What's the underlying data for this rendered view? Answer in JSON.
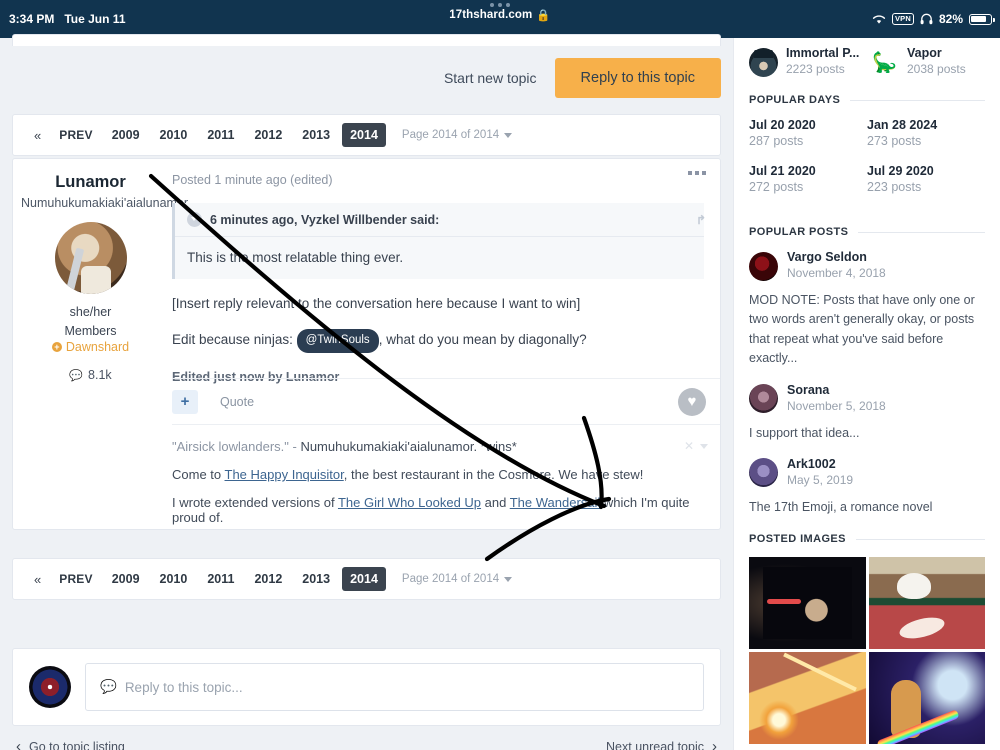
{
  "statusbar": {
    "time": "3:34 PM",
    "date": "Tue Jun 11",
    "url": "17thshard.com",
    "lock_icon": "lock-icon",
    "wifi_icon": "wifi-icon",
    "vpn_label": "VPN",
    "headphones_icon": "headphones-icon",
    "battery_percent": "82%",
    "battery_icon": "battery-icon",
    "bg_color": "#11344f"
  },
  "toolbar": {
    "start_new_topic": "Start new topic",
    "reply_to_topic": "Reply to this topic",
    "accent_color": "#f7b04a"
  },
  "pagination": {
    "first_chevron": "«",
    "prev_label": "PREV",
    "pages": [
      "2009",
      "2010",
      "2011",
      "2012",
      "2013",
      "2014"
    ],
    "active_page": "2014",
    "page_label": "Page 2014 of 2014"
  },
  "post": {
    "author": {
      "name": "Lunamor",
      "title": "Numuhukumakiaki'aialunamor",
      "pronouns": "she/her",
      "group": "Members",
      "badge": "Dawnshard",
      "post_count": "8.1k",
      "avatar": "user-avatar"
    },
    "posted_line": "Posted 1 minute ago (edited)",
    "menu_icon": "more-options-icon",
    "quote": {
      "header": "6 minutes ago, Vyzkel Willbender said:",
      "collapse_icon": "collapse-icon",
      "share_icon": "share-arrow-icon",
      "text": "This is the most relatable thing ever."
    },
    "paragraph_1": "[Insert reply relevant to the conversation here because I want to win]",
    "paragraph_2_prefix": "Edit because ninjas:",
    "mention": "@TwinSouls",
    "paragraph_2_suffix": ", what do you mean by diagonally?",
    "edited_note": "Edited just now by Lunamor",
    "tools": {
      "plus_label": "+",
      "quote_label": "Quote",
      "react_icon": "heart-icon"
    },
    "signature": {
      "line1_quote": "\"Airsick lowlanders.\" - ",
      "line1_rest": "Numuhukumakiaki'aialunamor. *wins*",
      "line2_pre": "Come to ",
      "line2_link": "The Happy Inquisitor",
      "line2_post": ", the best restaurant in the Cosmere. We have stew!",
      "line3_pre": "I wrote extended versions of ",
      "line3_link1": "The Girl Who Looked Up",
      "line3_mid": " and ",
      "line3_link2": "The Wandersail",
      "line3_post": " which I'm quite proud of.",
      "close_icon": "close-icon",
      "caret_icon": "chevron-down-icon"
    }
  },
  "composer": {
    "avatar": "current-user-avatar",
    "placeholder": "Reply to this topic...",
    "icon": "comment-icon"
  },
  "bottom_nav": {
    "left_label": "Go to topic listing",
    "left_icon": "chevron-left-icon",
    "right_label": "Next unread topic",
    "right_icon": "chevron-right-icon"
  },
  "sidebar": {
    "top_users": [
      {
        "name": "Immortal P...",
        "posts": "2223 posts",
        "avatar": "user-avatar"
      },
      {
        "name": "Vapor",
        "posts": "2038 posts",
        "avatar": "dinosaur-avatar",
        "glyph": "🦕"
      }
    ],
    "popular_days": {
      "title": "POPULAR DAYS",
      "items": [
        {
          "date": "Jul 20 2020",
          "posts": "287 posts"
        },
        {
          "date": "Jan 28 2024",
          "posts": "273 posts"
        },
        {
          "date": "Jul 21 2020",
          "posts": "272 posts"
        },
        {
          "date": "Jul 29 2020",
          "posts": "223 posts"
        }
      ]
    },
    "popular_posts": {
      "title": "POPULAR POSTS",
      "items": [
        {
          "name": "Vargo Seldon",
          "date": "November 4, 2018",
          "text": "MOD NOTE: Posts that have only one or two words aren't generally okay, or posts that repeat what you've said before exactly..."
        },
        {
          "name": "Sorana",
          "date": "November 5, 2018",
          "text": "I support that idea..."
        },
        {
          "name": "Ark1002",
          "date": "May 5, 2019",
          "text": "The 17th Emoji, a romance novel"
        }
      ]
    },
    "posted_images": {
      "title": "POSTED IMAGES",
      "tiles": [
        "t-rex-laser-image",
        "screaming-cat-image",
        "laser-explosion-image",
        "rainbow-space-dog-image"
      ]
    }
  }
}
